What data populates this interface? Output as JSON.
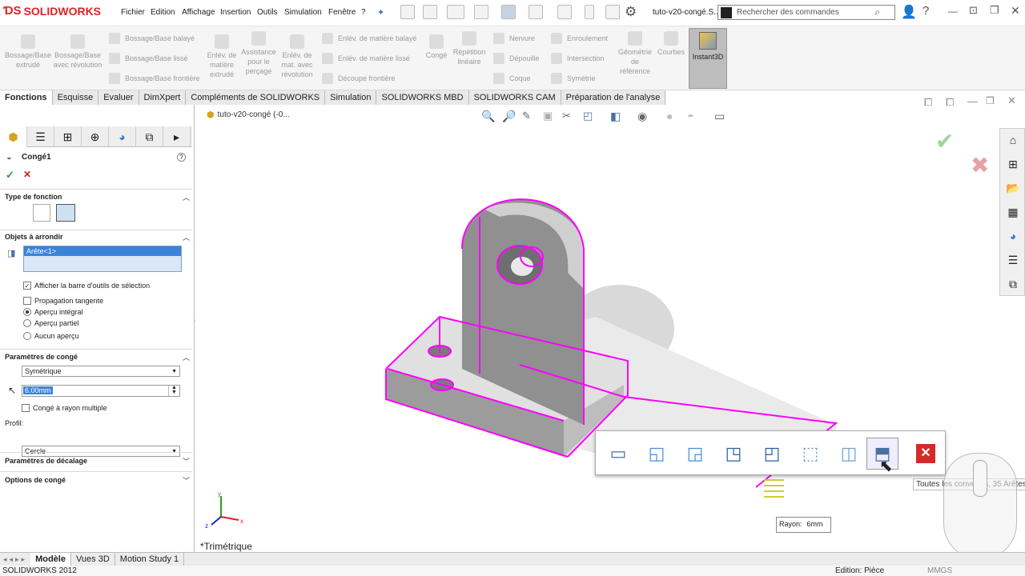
{
  "app": {
    "brand": "SOLIDWORKS",
    "window_title": "tuto-v20-congé.S..."
  },
  "menu": [
    "Fichier",
    "Edition",
    "Affichage",
    "Insertion",
    "Outils",
    "Simulation",
    "Fenêtre",
    "?"
  ],
  "search": {
    "placeholder": "Rechercher des commandes"
  },
  "ribbon": {
    "big": [
      {
        "name": "bossage-base-extrude",
        "label": "Bossage/Base extrudé"
      },
      {
        "name": "bossage-base-revolution",
        "label": "Bossage/Base avec révolution"
      },
      {
        "name": "enlev-matiere-extrude",
        "label": "Enlév. de matière extrudé"
      },
      {
        "name": "assistance-percage",
        "label": "Assistance pour le perçage"
      },
      {
        "name": "enlev-matiere-revolution",
        "label": "Enlév. de mat. avec révolution"
      },
      {
        "name": "conge",
        "label": "Congé"
      },
      {
        "name": "repetition-lineaire",
        "label": "Répétition linéaire"
      },
      {
        "name": "geometrie-reference",
        "label": "Géométrie de référence"
      },
      {
        "name": "courbes",
        "label": "Courbes"
      }
    ],
    "small": [
      "Bossage/Base balayé",
      "Bossage/Base lissé",
      "Bossage/Base frontière",
      "Enlév. de matière balayé",
      "Enlév. de matière lissé",
      "Découpe frontière",
      "Nervure",
      "Dépouille",
      "Coque",
      "Enroulement",
      "Intersection",
      "Symétrie"
    ],
    "instant3d": "Instant3D"
  },
  "tabs": [
    "Fonctions",
    "Esquisse",
    "Evaluer",
    "DimXpert",
    "Compléments de SOLIDWORKS",
    "Simulation",
    "SOLIDWORKS MBD",
    "SOLIDWORKS CAM",
    "Préparation de l'analyse"
  ],
  "panel": {
    "title": "Congé1",
    "help": "?",
    "ok": "✓",
    "cancel": "✕",
    "type_section": "Type de fonction",
    "objects_section": "Objets à arrondir",
    "objects_list": [
      "Arête<1>"
    ],
    "show_toolbar": "Afficher la barre d'outils de sélection",
    "tangent_prop": "Propagation tangente",
    "preview_full": "Aperçu intégral",
    "preview_partial": "Aperçu partiel",
    "preview_none": "Aucun aperçu",
    "params_section": "Paramètres de congé",
    "symmetry": "Symétrique",
    "radius_value": "6.00mm",
    "multi_radius": "Congé à rayon multiple",
    "profile_label": "Profil:",
    "profile_value": "Cercle",
    "offset_section": "Paramètres de décalage",
    "options_section": "Options de congé"
  },
  "viewport": {
    "doc_title": "tuto-v20-congé  (-0...",
    "view_name": "*Trimétrique",
    "tooltip": "Toutes les convexes, 35 Arêtes",
    "rayon_label": "Rayon:",
    "rayon_value": "6mm",
    "axes": {
      "x": "x",
      "y": "y",
      "z": "z"
    },
    "accent": "#ff00ff"
  },
  "bottom_tabs": [
    "Modèle",
    "Vues 3D",
    "Motion Study 1"
  ],
  "status": {
    "left": "SOLIDWORKS 2012",
    "mode": "Edition: Pièce",
    "units": "MMGS"
  }
}
